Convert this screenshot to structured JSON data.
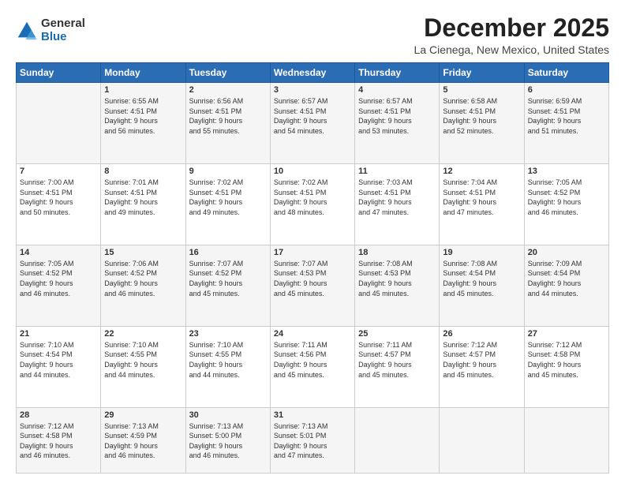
{
  "logo": {
    "general": "General",
    "blue": "Blue"
  },
  "title": "December 2025",
  "subtitle": "La Cienega, New Mexico, United States",
  "days_header": [
    "Sunday",
    "Monday",
    "Tuesday",
    "Wednesday",
    "Thursday",
    "Friday",
    "Saturday"
  ],
  "weeks": [
    [
      {
        "day": "",
        "info": ""
      },
      {
        "day": "1",
        "info": "Sunrise: 6:55 AM\nSunset: 4:51 PM\nDaylight: 9 hours\nand 56 minutes."
      },
      {
        "day": "2",
        "info": "Sunrise: 6:56 AM\nSunset: 4:51 PM\nDaylight: 9 hours\nand 55 minutes."
      },
      {
        "day": "3",
        "info": "Sunrise: 6:57 AM\nSunset: 4:51 PM\nDaylight: 9 hours\nand 54 minutes."
      },
      {
        "day": "4",
        "info": "Sunrise: 6:57 AM\nSunset: 4:51 PM\nDaylight: 9 hours\nand 53 minutes."
      },
      {
        "day": "5",
        "info": "Sunrise: 6:58 AM\nSunset: 4:51 PM\nDaylight: 9 hours\nand 52 minutes."
      },
      {
        "day": "6",
        "info": "Sunrise: 6:59 AM\nSunset: 4:51 PM\nDaylight: 9 hours\nand 51 minutes."
      }
    ],
    [
      {
        "day": "7",
        "info": "Sunrise: 7:00 AM\nSunset: 4:51 PM\nDaylight: 9 hours\nand 50 minutes."
      },
      {
        "day": "8",
        "info": "Sunrise: 7:01 AM\nSunset: 4:51 PM\nDaylight: 9 hours\nand 49 minutes."
      },
      {
        "day": "9",
        "info": "Sunrise: 7:02 AM\nSunset: 4:51 PM\nDaylight: 9 hours\nand 49 minutes."
      },
      {
        "day": "10",
        "info": "Sunrise: 7:02 AM\nSunset: 4:51 PM\nDaylight: 9 hours\nand 48 minutes."
      },
      {
        "day": "11",
        "info": "Sunrise: 7:03 AM\nSunset: 4:51 PM\nDaylight: 9 hours\nand 47 minutes."
      },
      {
        "day": "12",
        "info": "Sunrise: 7:04 AM\nSunset: 4:51 PM\nDaylight: 9 hours\nand 47 minutes."
      },
      {
        "day": "13",
        "info": "Sunrise: 7:05 AM\nSunset: 4:52 PM\nDaylight: 9 hours\nand 46 minutes."
      }
    ],
    [
      {
        "day": "14",
        "info": "Sunrise: 7:05 AM\nSunset: 4:52 PM\nDaylight: 9 hours\nand 46 minutes."
      },
      {
        "day": "15",
        "info": "Sunrise: 7:06 AM\nSunset: 4:52 PM\nDaylight: 9 hours\nand 46 minutes."
      },
      {
        "day": "16",
        "info": "Sunrise: 7:07 AM\nSunset: 4:52 PM\nDaylight: 9 hours\nand 45 minutes."
      },
      {
        "day": "17",
        "info": "Sunrise: 7:07 AM\nSunset: 4:53 PM\nDaylight: 9 hours\nand 45 minutes."
      },
      {
        "day": "18",
        "info": "Sunrise: 7:08 AM\nSunset: 4:53 PM\nDaylight: 9 hours\nand 45 minutes."
      },
      {
        "day": "19",
        "info": "Sunrise: 7:08 AM\nSunset: 4:54 PM\nDaylight: 9 hours\nand 45 minutes."
      },
      {
        "day": "20",
        "info": "Sunrise: 7:09 AM\nSunset: 4:54 PM\nDaylight: 9 hours\nand 44 minutes."
      }
    ],
    [
      {
        "day": "21",
        "info": "Sunrise: 7:10 AM\nSunset: 4:54 PM\nDaylight: 9 hours\nand 44 minutes."
      },
      {
        "day": "22",
        "info": "Sunrise: 7:10 AM\nSunset: 4:55 PM\nDaylight: 9 hours\nand 44 minutes."
      },
      {
        "day": "23",
        "info": "Sunrise: 7:10 AM\nSunset: 4:55 PM\nDaylight: 9 hours\nand 44 minutes."
      },
      {
        "day": "24",
        "info": "Sunrise: 7:11 AM\nSunset: 4:56 PM\nDaylight: 9 hours\nand 45 minutes."
      },
      {
        "day": "25",
        "info": "Sunrise: 7:11 AM\nSunset: 4:57 PM\nDaylight: 9 hours\nand 45 minutes."
      },
      {
        "day": "26",
        "info": "Sunrise: 7:12 AM\nSunset: 4:57 PM\nDaylight: 9 hours\nand 45 minutes."
      },
      {
        "day": "27",
        "info": "Sunrise: 7:12 AM\nSunset: 4:58 PM\nDaylight: 9 hours\nand 45 minutes."
      }
    ],
    [
      {
        "day": "28",
        "info": "Sunrise: 7:12 AM\nSunset: 4:58 PM\nDaylight: 9 hours\nand 46 minutes."
      },
      {
        "day": "29",
        "info": "Sunrise: 7:13 AM\nSunset: 4:59 PM\nDaylight: 9 hours\nand 46 minutes."
      },
      {
        "day": "30",
        "info": "Sunrise: 7:13 AM\nSunset: 5:00 PM\nDaylight: 9 hours\nand 46 minutes."
      },
      {
        "day": "31",
        "info": "Sunrise: 7:13 AM\nSunset: 5:01 PM\nDaylight: 9 hours\nand 47 minutes."
      },
      {
        "day": "",
        "info": ""
      },
      {
        "day": "",
        "info": ""
      },
      {
        "day": "",
        "info": ""
      }
    ]
  ]
}
